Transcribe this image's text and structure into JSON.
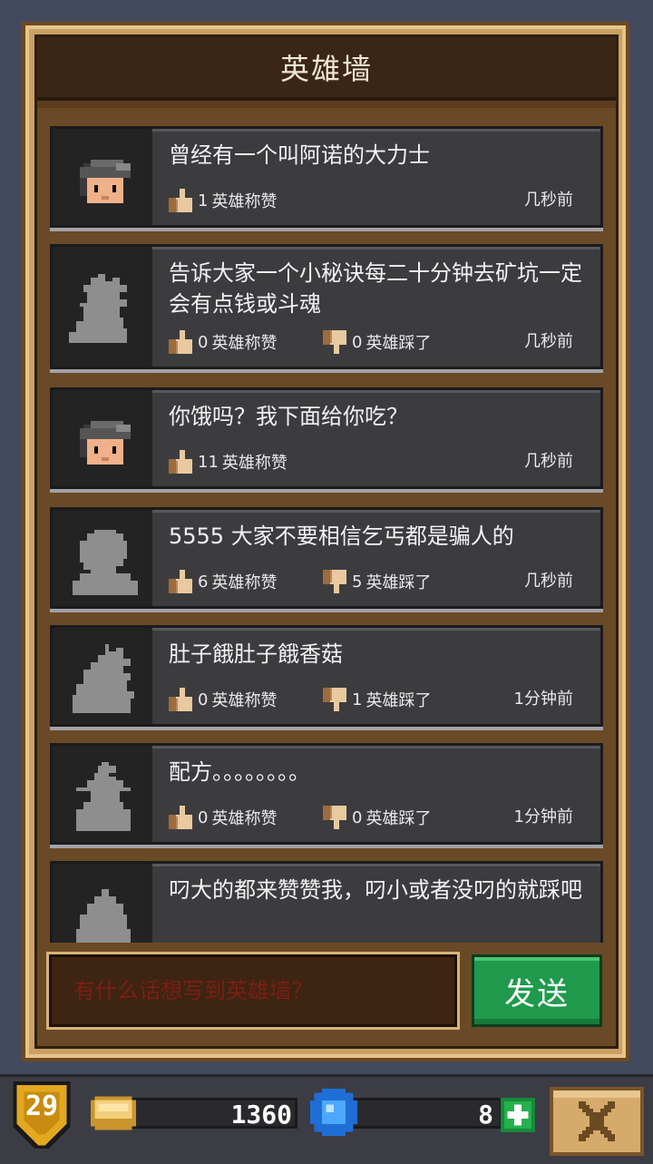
{
  "header": {
    "title": "英雄墙"
  },
  "posts": [
    {
      "text": "曾经有一个叫阿诺的大力士",
      "likes": "1",
      "likes_label": "英雄称赞",
      "dislikes": null,
      "dislikes_label": null,
      "time": "几秒前",
      "avatar": "helmet-hero"
    },
    {
      "text": "告诉大家一个小秘诀每二十分钟去矿坑一定会有点钱或斗魂",
      "likes": "0",
      "likes_label": "英雄称赞",
      "dislikes": "0",
      "dislikes_label": "英雄踩了",
      "time": "几秒前",
      "avatar": "silhouette-spiky"
    },
    {
      "text": "你饿吗？我下面给你吃？",
      "likes": "11",
      "likes_label": "英雄称赞",
      "dislikes": null,
      "dislikes_label": null,
      "time": "几秒前",
      "avatar": "helmet-hero"
    },
    {
      "text": "5555 大家不要相信乞丐都是骗人的",
      "likes": "6",
      "likes_label": "英雄称赞",
      "dislikes": "5",
      "dislikes_label": "英雄踩了",
      "time": "几秒前",
      "avatar": "silhouette-round"
    },
    {
      "text": "肚子餓肚子餓香菇",
      "likes": "0",
      "likes_label": "英雄称赞",
      "dislikes": "1",
      "dislikes_label": "英雄踩了",
      "time": "1分钟前",
      "avatar": "silhouette-wild"
    },
    {
      "text": "配方。。。。。。。。",
      "likes": "0",
      "likes_label": "英雄称赞",
      "dislikes": "0",
      "dislikes_label": "英雄踩了",
      "time": "1分钟前",
      "avatar": "silhouette-hat"
    },
    {
      "text": "叼大的都来赞赞我，叼小或者没叼的就踩吧",
      "likes": null,
      "likes_label": null,
      "dislikes": null,
      "dislikes_label": null,
      "time": null,
      "avatar": "silhouette-drop"
    }
  ],
  "composer": {
    "placeholder": "有什么话想写到英雄墙？",
    "send_label": "发送"
  },
  "hud": {
    "level": "29",
    "gold": "1360",
    "gems": "8"
  },
  "colors": {
    "send_green": "#1f9a4c",
    "placeholder_red": "#7a1f14",
    "wood": "#caa064",
    "card_bg": "#3c3c3e"
  }
}
